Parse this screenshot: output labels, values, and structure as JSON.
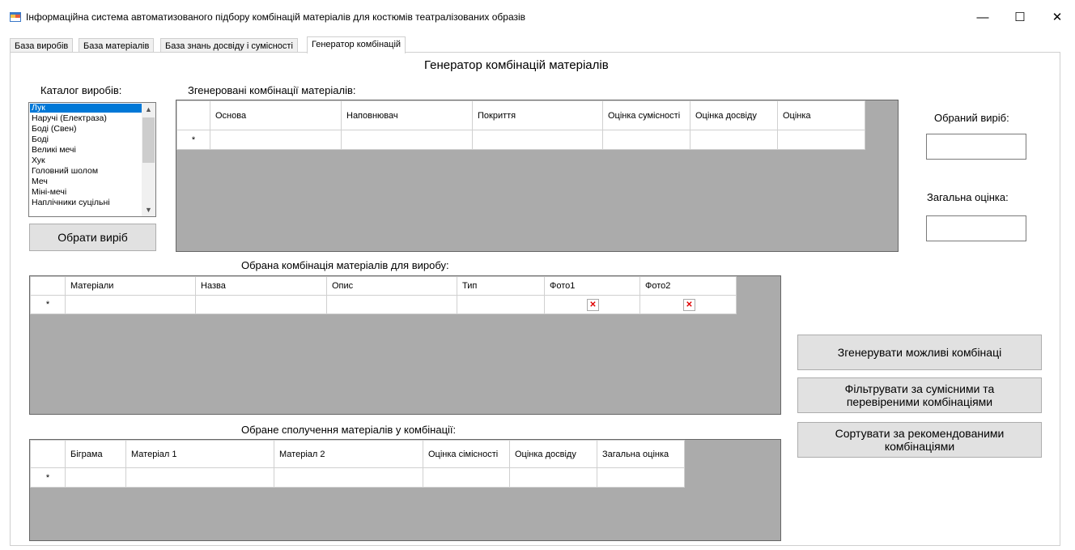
{
  "window": {
    "title": "Інформаційна система автоматизованого підбору комбінацій матеріалів для костюмів театралізованих образів",
    "minimize": "—",
    "maximize": "☐",
    "close": "✕"
  },
  "tabs": [
    {
      "label": "База виробів"
    },
    {
      "label": "База матеріалів"
    },
    {
      "label": "База знань досвіду і сумісності"
    },
    {
      "label": "Генератор комбінацій"
    }
  ],
  "page_title": "Генератор комбінацій матеріалів",
  "catalog": {
    "label": "Каталог виробів:",
    "items": [
      "Лук",
      "Наручі (Електраза)",
      "Боді (Свен)",
      "Боді",
      "Великі мечі",
      "Хук",
      "Головний шолом",
      "Меч",
      "Міні-мечі",
      "Наплічники суцільні"
    ],
    "selected": "Лук",
    "select_button": "Обрати виріб"
  },
  "generated": {
    "label": "Згенеровані комбінації матеріалів:",
    "columns": [
      "Основа",
      "Наповнювач",
      "Покриття",
      "Оцінка сумісності",
      "Оцінка досвіду",
      "Оцінка"
    ]
  },
  "side": {
    "selected_label": "Обраний виріб:",
    "total_label": "Загальна оцінка:",
    "generate_button": "Згенерувати можливі комбінаці",
    "filter_button": "Фільтрувати за сумісними та перевіреними комбінаціями",
    "sort_button": "Сортувати за рекомендованими комбінаціями"
  },
  "selected_combo": {
    "label": "Обрана комбінація матеріалів для виробу:",
    "columns": [
      "Матеріали",
      "Назва",
      "Опис",
      "Тип",
      "Фото1",
      "Фото2"
    ]
  },
  "pairs": {
    "label": "Обране сполучення матеріалів у комбінації:",
    "columns": [
      "Біграма",
      "Матеріал 1",
      "Матеріал 2",
      "Оцінка сімісності",
      "Оцінка досвіду",
      "Загальна оцінка"
    ]
  },
  "new_row_marker": "*",
  "colors": {
    "selection": "#0078d7",
    "grid_bg": "#ababab"
  }
}
